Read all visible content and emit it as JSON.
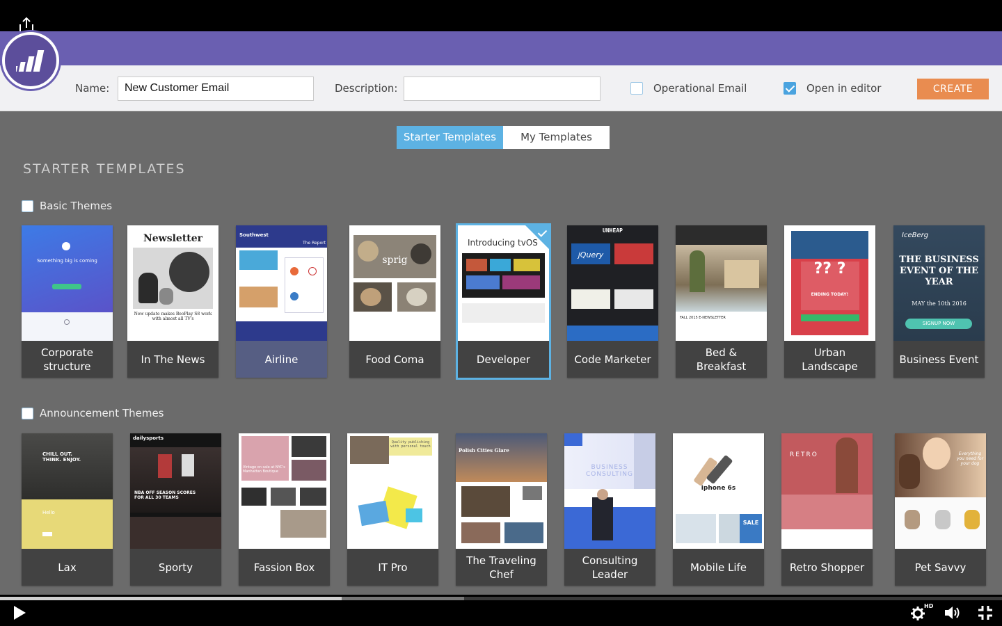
{
  "form": {
    "name_label": "Name:",
    "name_value": "New Customer Email",
    "description_label": "Description:",
    "description_value": "",
    "operational_label": "Operational Email",
    "operational_checked": false,
    "open_editor_label": "Open in editor",
    "open_editor_checked": true,
    "create_label": "CREATE"
  },
  "tabs": {
    "starter": "Starter Templates",
    "mine": "My Templates",
    "active": "starter"
  },
  "section_title": "STARTER TEMPLATES",
  "groups": {
    "basic": {
      "label": "Basic Themes",
      "cards": [
        {
          "caption": "Corporate structure",
          "thumb_text": "Something big is coming"
        },
        {
          "caption": "In The News",
          "thumb_text": "Newsletter",
          "thumb_sub": "New update makes BeoPlay S8 work with almost all TV's"
        },
        {
          "caption": "Airline",
          "thumb_text": "Southwest",
          "thumb_sub": "The Report"
        },
        {
          "caption": "Food Coma",
          "thumb_text": "sprig"
        },
        {
          "caption": "Developer",
          "thumb_text": "Introducing tvOS",
          "selected": true
        },
        {
          "caption": "Code Marketer",
          "thumb_text": "jQuery"
        },
        {
          "caption": "Bed & Breakfast",
          "thumb_text": "FALL 2015 E-NEWSLETTER"
        },
        {
          "caption": "Urban Landscape",
          "thumb_text": "?? ?",
          "thumb_sub": "ENDING TODAY!"
        },
        {
          "caption": "Business Event",
          "thumb_text": "THE BUSINESS EVENT OF THE YEAR",
          "thumb_sub": "MAY the 10th 2016",
          "thumb_brand": "IceBerg",
          "thumb_btn": "SIGNUP NOW"
        }
      ]
    },
    "announce": {
      "label": "Announcement Themes",
      "cards": [
        {
          "caption": "Lax",
          "thumb_text": "CHILL OUT. THINK. ENJOY.",
          "thumb_sub": "Hello"
        },
        {
          "caption": "Sporty",
          "thumb_text": "NBA OFF SEASON SCORES FOR ALL 30 TEAMS",
          "thumb_brand": "dailysports"
        },
        {
          "caption": "Fassion Box",
          "thumb_text": "Vintage on sale at NYC's Manhattan Boutique"
        },
        {
          "caption": "IT Pro",
          "thumb_text": "Quality publishing with personal touch"
        },
        {
          "caption": "The Traveling Chef",
          "thumb_text": "Polish Cities Glare"
        },
        {
          "caption": "Consulting Leader",
          "thumb_text": "BUSINESS CONSULTING"
        },
        {
          "caption": "Mobile Life",
          "thumb_text": "iphone 6s",
          "thumb_sub": "SALE"
        },
        {
          "caption": "Retro Shopper",
          "thumb_text": "RETRO"
        },
        {
          "caption": "Pet Savvy",
          "thumb_text": "Everything you need for your dog"
        }
      ]
    }
  },
  "video": {
    "progress": 0.341,
    "buffered": 0.463,
    "quality": "HD"
  },
  "colors": {
    "brand_purple": "#6a5fb1",
    "accent_blue": "#5db2e3",
    "create_orange": "#e98c50",
    "gallery_bg": "#6b6b6b"
  }
}
